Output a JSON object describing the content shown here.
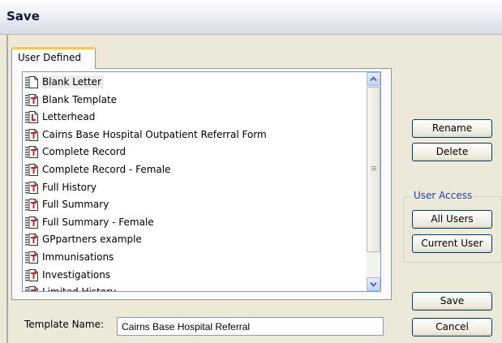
{
  "window": {
    "title": "Save"
  },
  "tabs": [
    {
      "label": "User Defined"
    }
  ],
  "template_list": {
    "items": [
      {
        "label": "Blank Letter",
        "icon": "blank-document-icon",
        "selected": true
      },
      {
        "label": "Blank Template",
        "icon": "template-document-icon"
      },
      {
        "label": "Letterhead",
        "icon": "letterhead-document-icon"
      },
      {
        "label": "Cairns Base Hospital Outpatient Referral Form",
        "icon": "template-document-icon"
      },
      {
        "label": "Complete Record",
        "icon": "template-document-icon"
      },
      {
        "label": "Complete Record - Female",
        "icon": "template-document-icon"
      },
      {
        "label": "Full History",
        "icon": "template-document-icon"
      },
      {
        "label": "Full Summary",
        "icon": "template-document-icon"
      },
      {
        "label": "Full Summary - Female",
        "icon": "template-document-icon"
      },
      {
        "label": "GPpartners example",
        "icon": "template-document-icon"
      },
      {
        "label": "Immunisations",
        "icon": "template-document-icon"
      },
      {
        "label": "Investigations",
        "icon": "template-document-icon"
      },
      {
        "label": "Limited History",
        "icon": "template-document-icon"
      }
    ]
  },
  "buttons": {
    "rename": "Rename",
    "delete": "Delete",
    "save": "Save",
    "cancel": "Cancel"
  },
  "user_access": {
    "legend": "User Access",
    "all_users": "All Users",
    "current_user": "Current User"
  },
  "template_name": {
    "label": "Template Name:",
    "value": "Cairns Base Hospital Referral"
  },
  "colors": {
    "accent_tab": "#ffc83c",
    "group_legend": "#1d43ae",
    "icon_red": "#d42020"
  }
}
